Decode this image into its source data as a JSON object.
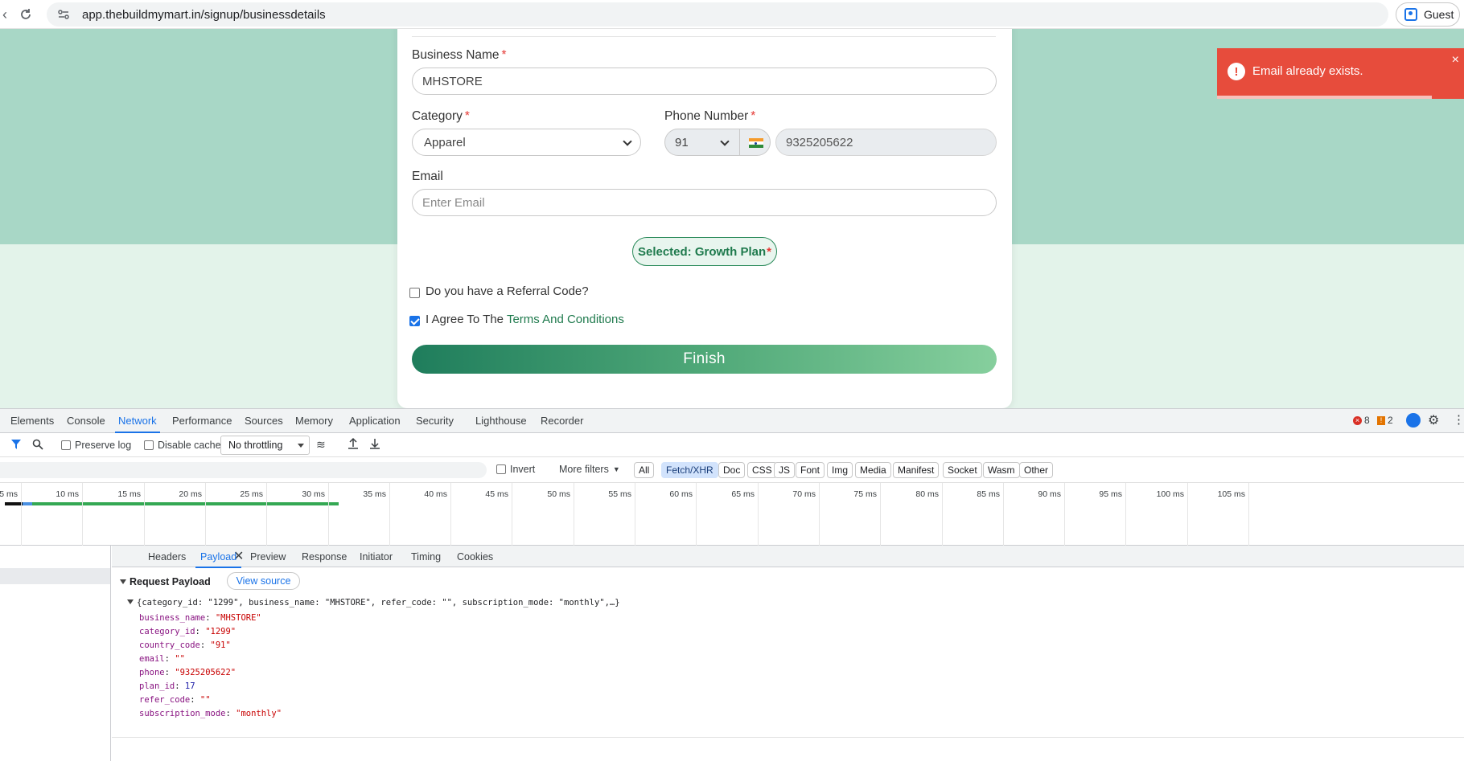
{
  "browser": {
    "url": "app.thebuildmymart.in/signup/businessdetails",
    "profile_label": "Guest"
  },
  "form": {
    "business_name_label": "Business Name",
    "business_name_value": "MHSTORE",
    "category_label": "Category",
    "category_value": "Apparel",
    "phone_label": "Phone Number",
    "country_code": "91",
    "phone_value": "9325205622",
    "email_label": "Email",
    "email_placeholder": "Enter Email",
    "required_mark": "*",
    "plan_badge": "Selected: Growth Plan",
    "referral_label": "Do you have a Referral Code?",
    "referral_checked": false,
    "agree_prefix": "I Agree To The",
    "agree_link": "Terms And Conditions",
    "agree_checked": true,
    "finish_label": "Finish"
  },
  "toast": {
    "message": "Email already exists.",
    "icon": "!",
    "close": "×",
    "color": "#e74c3c"
  },
  "devtools": {
    "tabs": [
      "Elements",
      "Console",
      "Network",
      "Performance",
      "Sources",
      "Memory",
      "Application",
      "Security",
      "Lighthouse",
      "Recorder"
    ],
    "active_tab": "Network",
    "error_count": "8",
    "warning_count": "2",
    "toolbar": {
      "preserve_log": "Preserve log",
      "disable_cache": "Disable cache",
      "throttling": "No throttling"
    },
    "filter": {
      "invert": "Invert",
      "more_filters": "More filters",
      "chips": [
        "All",
        "Fetch/XHR",
        "Doc",
        "CSS",
        "JS",
        "Font",
        "Img",
        "Media",
        "Manifest",
        "Socket",
        "Wasm",
        "Other"
      ],
      "active_chip": "Fetch/XHR"
    },
    "timeline_ticks": [
      "5 ms",
      "10 ms",
      "15 ms",
      "20 ms",
      "25 ms",
      "30 ms",
      "35 ms",
      "40 ms",
      "45 ms",
      "50 ms",
      "55 ms",
      "60 ms",
      "65 ms",
      "70 ms",
      "75 ms",
      "80 ms",
      "85 ms",
      "90 ms",
      "95 ms",
      "100 ms",
      "105 ms"
    ],
    "detail_tabs": [
      "Headers",
      "Payload",
      "Preview",
      "Response",
      "Initiator",
      "Timing",
      "Cookies"
    ],
    "active_detail_tab": "Payload",
    "payload": {
      "heading": "Request Payload",
      "view_source": "View source",
      "summary": "{category_id: \"1299\", business_name: \"MHSTORE\", refer_code: \"\", subscription_mode: \"monthly\",…}",
      "fields": [
        {
          "key": "business_name",
          "value": "\"MHSTORE\"",
          "type": "string"
        },
        {
          "key": "category_id",
          "value": "\"1299\"",
          "type": "string"
        },
        {
          "key": "country_code",
          "value": "\"91\"",
          "type": "string"
        },
        {
          "key": "email",
          "value": "\"\"",
          "type": "string"
        },
        {
          "key": "phone",
          "value": "\"9325205622\"",
          "type": "string"
        },
        {
          "key": "plan_id",
          "value": "17",
          "type": "number"
        },
        {
          "key": "refer_code",
          "value": "\"\"",
          "type": "string"
        },
        {
          "key": "subscription_mode",
          "value": "\"monthly\"",
          "type": "string"
        }
      ]
    }
  }
}
